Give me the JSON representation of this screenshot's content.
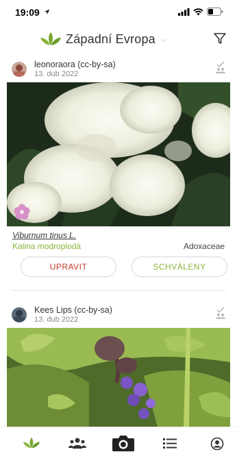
{
  "status_bar": {
    "time": "19:09"
  },
  "header": {
    "region": "Západní Evropa"
  },
  "observations": [
    {
      "author": "leonoraora (cc-by-sa)",
      "date": "13. dub 2022",
      "scientific_name": "Viburnum tinus L.",
      "common_name": "Kalina modroplodá",
      "family": "Adoxaceae",
      "edit_label": "UPRAVIT",
      "approve_label": "SCHVÁLENY"
    },
    {
      "author": "Kees Lips (cc-by-sa)",
      "date": "13. dub 2022"
    }
  ],
  "colors": {
    "accent_green": "#8bb43a",
    "accent_red": "#c0392b"
  },
  "tabs": [
    {
      "icon": "leaf-icon"
    },
    {
      "icon": "people-icon"
    },
    {
      "icon": "camera-icon"
    },
    {
      "icon": "list-icon"
    },
    {
      "icon": "profile-icon"
    }
  ]
}
